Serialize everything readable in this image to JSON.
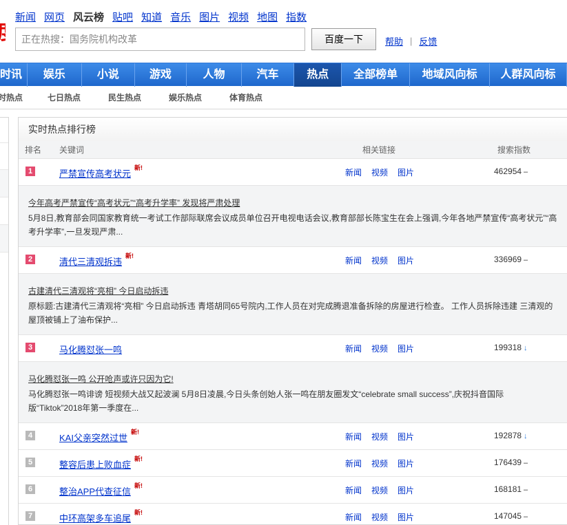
{
  "top_nav": [
    {
      "label": "新闻",
      "current": false
    },
    {
      "label": "网页",
      "current": false
    },
    {
      "label": "风云榜",
      "current": true
    },
    {
      "label": "贴吧",
      "current": false
    },
    {
      "label": "知道",
      "current": false
    },
    {
      "label": "音乐",
      "current": false
    },
    {
      "label": "图片",
      "current": false
    },
    {
      "label": "视频",
      "current": false
    },
    {
      "label": "地图",
      "current": false
    },
    {
      "label": "指数",
      "current": false
    }
  ],
  "logo_fragment": "度",
  "search": {
    "value": "正在热搜：国务院机构改革",
    "button": "百度一下"
  },
  "help_links": {
    "help": "帮助",
    "separator": "|",
    "feedback": "反馈"
  },
  "categories": [
    {
      "label": "时讯",
      "active": false
    },
    {
      "label": "娱乐",
      "active": false
    },
    {
      "label": "小说",
      "active": false
    },
    {
      "label": "游戏",
      "active": false
    },
    {
      "label": "人物",
      "active": false
    },
    {
      "label": "汽车",
      "active": false
    },
    {
      "label": "热点",
      "active": true
    },
    {
      "label": "全部榜单",
      "active": false
    },
    {
      "label": "地域风向标",
      "active": false
    },
    {
      "label": "人群风向标",
      "active": false
    }
  ],
  "sub_nav": [
    "时热点",
    "七日热点",
    "民生热点",
    "娱乐热点",
    "体育热点"
  ],
  "panel": {
    "title": "实时热点排行榜",
    "headers": {
      "rank": "排名",
      "keyword": "关键词",
      "links": "相关链接",
      "index": "搜索指数"
    }
  },
  "link_labels": [
    "新闻",
    "视频",
    "图片"
  ],
  "new_badge": "新!",
  "rows": [
    {
      "rank": "1",
      "keyword": "严禁宣传高考状元",
      "is_new": true,
      "index": "462954",
      "trend": "–",
      "trend_type": "flat",
      "hot": true,
      "detail": {
        "title": "今年高考严禁宣传“高考状元”“高考升学率” 发现将严肃处理",
        "text": "5月8日,教育部会同国家教育统一考试工作部际联席会议成员单位召开电视电话会议,教育部部长陈宝生在会上强调,今年各地严禁宣传“高考状元”“高考升学率”,一旦发现严肃..."
      }
    },
    {
      "rank": "2",
      "keyword": "清代三清观拆违",
      "is_new": true,
      "index": "336969",
      "trend": "–",
      "trend_type": "flat",
      "hot": true,
      "detail": {
        "title": "古建清代三清观将“亮相” 今日启动拆违",
        "text": "原标题:古建清代三清观将“亮相” 今日启动拆违 青塔胡同65号院内,工作人员在对完成腾退准备拆除的房屋进行检查。 工作人员拆除违建 三清观的屋顶被铺上了油布保护..."
      }
    },
    {
      "rank": "3",
      "keyword": "马化腾怼张一鸣",
      "is_new": false,
      "index": "199318",
      "trend": "↓",
      "trend_type": "down",
      "hot": true,
      "detail": {
        "title": "马化腾怼张一鸣 公开呛声或许只因为它!",
        "text": "马化腾怼张一鸣诽谤 短视频大战又起波澜 5月8日凌晨,今日头条创始人张一鸣在朋友圈发文“celebrate small success”,庆祝抖音国际版“Tiktok”2018年第一季度在..."
      }
    },
    {
      "rank": "4",
      "keyword": "KAI父亲突然过世",
      "is_new": true,
      "index": "192878",
      "trend": "↓",
      "trend_type": "down",
      "hot": false,
      "detail": null
    },
    {
      "rank": "5",
      "keyword": "整容后患上败血症",
      "is_new": true,
      "index": "176439",
      "trend": "–",
      "trend_type": "flat",
      "hot": false,
      "detail": null
    },
    {
      "rank": "6",
      "keyword": "整治APP代查征信",
      "is_new": true,
      "index": "168181",
      "trend": "–",
      "trend_type": "flat",
      "hot": false,
      "detail": null
    },
    {
      "rank": "7",
      "keyword": "中环高架多车追尾",
      "is_new": true,
      "index": "147045",
      "trend": "–",
      "trend_type": "flat",
      "hot": false,
      "detail": null
    }
  ]
}
